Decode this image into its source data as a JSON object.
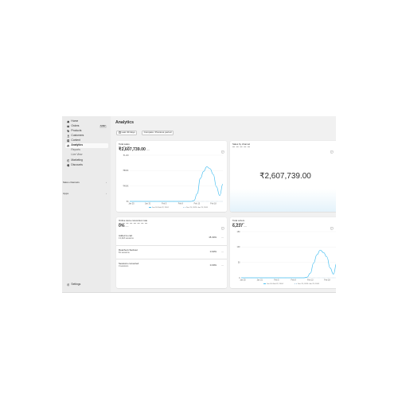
{
  "sidebar": {
    "items": [
      {
        "label": "Home",
        "icon": "home-icon"
      },
      {
        "label": "Orders",
        "icon": "orders-icon",
        "badge": "5,897"
      },
      {
        "label": "Products",
        "icon": "tag-icon"
      },
      {
        "label": "Customers",
        "icon": "person-icon"
      },
      {
        "label": "Content",
        "icon": "content-icon"
      },
      {
        "label": "Analytics",
        "icon": "chart-icon",
        "active": true
      },
      {
        "label": "Reports",
        "sub": true
      },
      {
        "label": "Live View",
        "sub": true
      },
      {
        "label": "Marketing",
        "icon": "target-icon"
      },
      {
        "label": "Discounts",
        "icon": "discount-icon"
      }
    ],
    "sections": [
      {
        "label": "Sales channels"
      },
      {
        "label": "Apps"
      }
    ],
    "settings_label": "Settings"
  },
  "page": {
    "title": "Analytics",
    "date_button": "Last 30 days",
    "compare_button": "Compare: Previous period"
  },
  "cards": {
    "total_sales": {
      "title": "Total sales",
      "value": "₹2,607,739.00",
      "dash": "—",
      "legend_current": "Jan 24–Feb 22, 2024",
      "legend_previous": "Dec 25, 2023–Jan 23, 2024"
    },
    "sales_by_channel": {
      "title": "Sales by channel",
      "value": "₹2,607,739.00"
    },
    "conversion": {
      "title": "Online store conversion rate",
      "value": "0%",
      "dash": "—",
      "rows": [
        {
          "label": "Added to cart",
          "sub": "13,318 sessions",
          "pct": "15.34%",
          "dash": "—"
        },
        {
          "label": "Reached checkout",
          "sub": "81 sessions",
          "pct": "0.93%",
          "dash": "—"
        },
        {
          "label": "Sessions converted",
          "sub": "0 sessions",
          "pct": "0.00%",
          "dash": "—"
        }
      ]
    },
    "total_orders": {
      "title": "Total orders",
      "value": "6,237",
      "dash": "—",
      "legend_current": "Jan 24–Feb 22, 2024",
      "legend_previous": "Dec 25, 2023–Jan 23, 2024"
    }
  },
  "colors": {
    "series_current": "#4ac0f1",
    "series_previous": "#a9c9dd",
    "sidebar_bg": "#ebebeb",
    "app_bg": "#f1f1f1"
  },
  "chart_data": [
    {
      "type": "line",
      "title": "Total sales",
      "x_ticks": [
        "Jan 25",
        "Jan 31",
        "Feb 5",
        "Feb 8",
        "Feb 13",
        "Feb 18"
      ],
      "y_ticks": [
        "₹0",
        "₹400K",
        "₹800K",
        "₹1.2M"
      ],
      "ylim": [
        0,
        1200000
      ],
      "series": [
        {
          "name": "Jan 24–Feb 22, 2024",
          "values": [
            0,
            0,
            0,
            0,
            0,
            0,
            0,
            0,
            0,
            0,
            0,
            0,
            0,
            0,
            0,
            0,
            0,
            0,
            0,
            0,
            20000,
            200000,
            600000,
            780000,
            900000,
            850000,
            700000,
            380000,
            150000,
            450000
          ]
        }
      ]
    },
    {
      "type": "line",
      "title": "Total orders",
      "x_ticks": [
        "Jan 25",
        "Jan 31",
        "Feb 5",
        "Feb 8",
        "Feb 13",
        "Feb 18"
      ],
      "y_ticks": [
        "0",
        "50",
        "100",
        "150"
      ],
      "ylim": [
        0,
        150
      ],
      "series": [
        {
          "name": "Jan 24–Feb 22, 2024",
          "values": [
            0,
            0,
            0,
            0,
            0,
            0,
            0,
            0,
            0,
            0,
            0,
            0,
            0,
            0,
            0,
            0,
            0,
            0,
            0,
            0,
            2,
            15,
            48,
            75,
            90,
            82,
            68,
            32,
            12,
            48
          ]
        }
      ]
    }
  ]
}
